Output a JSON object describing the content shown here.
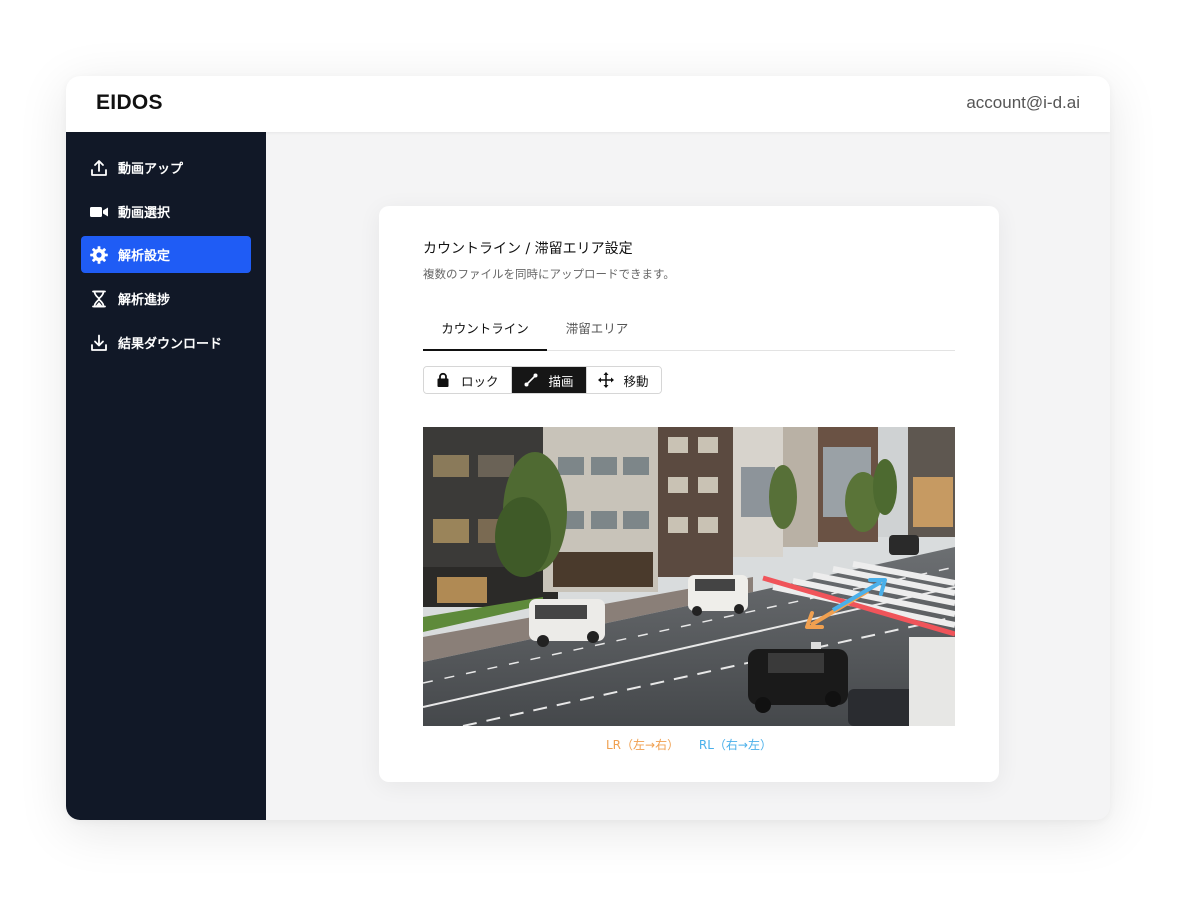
{
  "app": {
    "brand": "EIDOS",
    "account": "account@i-d.ai"
  },
  "sidebar": {
    "items": [
      {
        "label": "動画アップ",
        "icon": "upload-icon",
        "active": false
      },
      {
        "label": "動画選択",
        "icon": "video-camera-icon",
        "active": false
      },
      {
        "label": "解析設定",
        "icon": "gear-icon",
        "active": true
      },
      {
        "label": "解析進捗",
        "icon": "hourglass-icon",
        "active": false
      },
      {
        "label": "結果ダウンロード",
        "icon": "download-icon",
        "active": false
      }
    ]
  },
  "card": {
    "title": "カウントライン / 滞留エリア設定",
    "subtitle": "複数のファイルを同時にアップロードできます。",
    "tabs": [
      {
        "label": "カウントライン",
        "active": true
      },
      {
        "label": "滞留エリア",
        "active": false
      }
    ],
    "tools": [
      {
        "label": "ロック",
        "icon": "lock-icon",
        "active": false
      },
      {
        "label": "描画",
        "icon": "draw-line-icon",
        "active": true
      },
      {
        "label": "移動",
        "icon": "move-icon",
        "active": false
      }
    ],
    "legend": {
      "lr": "LR（左→右）",
      "rl": "RL（右→左）"
    }
  },
  "colors": {
    "accent": "#1f5cf5",
    "sidebar_bg": "#111827",
    "count_line": "#f0545a",
    "lr_arrow": "#f0a050",
    "rl_arrow": "#4ab0ea"
  }
}
